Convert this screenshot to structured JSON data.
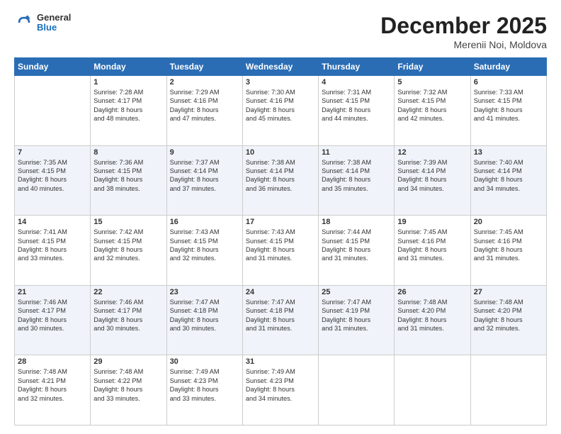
{
  "header": {
    "logo": {
      "general": "General",
      "blue": "Blue"
    },
    "title": "December 2025",
    "subtitle": "Merenii Noi, Moldova"
  },
  "weekdays": [
    "Sunday",
    "Monday",
    "Tuesday",
    "Wednesday",
    "Thursday",
    "Friday",
    "Saturday"
  ],
  "rows": [
    [
      {
        "day": "",
        "content": ""
      },
      {
        "day": "1",
        "content": "Sunrise: 7:28 AM\nSunset: 4:17 PM\nDaylight: 8 hours\nand 48 minutes."
      },
      {
        "day": "2",
        "content": "Sunrise: 7:29 AM\nSunset: 4:16 PM\nDaylight: 8 hours\nand 47 minutes."
      },
      {
        "day": "3",
        "content": "Sunrise: 7:30 AM\nSunset: 4:16 PM\nDaylight: 8 hours\nand 45 minutes."
      },
      {
        "day": "4",
        "content": "Sunrise: 7:31 AM\nSunset: 4:15 PM\nDaylight: 8 hours\nand 44 minutes."
      },
      {
        "day": "5",
        "content": "Sunrise: 7:32 AM\nSunset: 4:15 PM\nDaylight: 8 hours\nand 42 minutes."
      },
      {
        "day": "6",
        "content": "Sunrise: 7:33 AM\nSunset: 4:15 PM\nDaylight: 8 hours\nand 41 minutes."
      }
    ],
    [
      {
        "day": "7",
        "content": "Sunrise: 7:35 AM\nSunset: 4:15 PM\nDaylight: 8 hours\nand 40 minutes."
      },
      {
        "day": "8",
        "content": "Sunrise: 7:36 AM\nSunset: 4:15 PM\nDaylight: 8 hours\nand 38 minutes."
      },
      {
        "day": "9",
        "content": "Sunrise: 7:37 AM\nSunset: 4:14 PM\nDaylight: 8 hours\nand 37 minutes."
      },
      {
        "day": "10",
        "content": "Sunrise: 7:38 AM\nSunset: 4:14 PM\nDaylight: 8 hours\nand 36 minutes."
      },
      {
        "day": "11",
        "content": "Sunrise: 7:38 AM\nSunset: 4:14 PM\nDaylight: 8 hours\nand 35 minutes."
      },
      {
        "day": "12",
        "content": "Sunrise: 7:39 AM\nSunset: 4:14 PM\nDaylight: 8 hours\nand 34 minutes."
      },
      {
        "day": "13",
        "content": "Sunrise: 7:40 AM\nSunset: 4:14 PM\nDaylight: 8 hours\nand 34 minutes."
      }
    ],
    [
      {
        "day": "14",
        "content": "Sunrise: 7:41 AM\nSunset: 4:15 PM\nDaylight: 8 hours\nand 33 minutes."
      },
      {
        "day": "15",
        "content": "Sunrise: 7:42 AM\nSunset: 4:15 PM\nDaylight: 8 hours\nand 32 minutes."
      },
      {
        "day": "16",
        "content": "Sunrise: 7:43 AM\nSunset: 4:15 PM\nDaylight: 8 hours\nand 32 minutes."
      },
      {
        "day": "17",
        "content": "Sunrise: 7:43 AM\nSunset: 4:15 PM\nDaylight: 8 hours\nand 31 minutes."
      },
      {
        "day": "18",
        "content": "Sunrise: 7:44 AM\nSunset: 4:15 PM\nDaylight: 8 hours\nand 31 minutes."
      },
      {
        "day": "19",
        "content": "Sunrise: 7:45 AM\nSunset: 4:16 PM\nDaylight: 8 hours\nand 31 minutes."
      },
      {
        "day": "20",
        "content": "Sunrise: 7:45 AM\nSunset: 4:16 PM\nDaylight: 8 hours\nand 31 minutes."
      }
    ],
    [
      {
        "day": "21",
        "content": "Sunrise: 7:46 AM\nSunset: 4:17 PM\nDaylight: 8 hours\nand 30 minutes."
      },
      {
        "day": "22",
        "content": "Sunrise: 7:46 AM\nSunset: 4:17 PM\nDaylight: 8 hours\nand 30 minutes."
      },
      {
        "day": "23",
        "content": "Sunrise: 7:47 AM\nSunset: 4:18 PM\nDaylight: 8 hours\nand 30 minutes."
      },
      {
        "day": "24",
        "content": "Sunrise: 7:47 AM\nSunset: 4:18 PM\nDaylight: 8 hours\nand 31 minutes."
      },
      {
        "day": "25",
        "content": "Sunrise: 7:47 AM\nSunset: 4:19 PM\nDaylight: 8 hours\nand 31 minutes."
      },
      {
        "day": "26",
        "content": "Sunrise: 7:48 AM\nSunset: 4:20 PM\nDaylight: 8 hours\nand 31 minutes."
      },
      {
        "day": "27",
        "content": "Sunrise: 7:48 AM\nSunset: 4:20 PM\nDaylight: 8 hours\nand 32 minutes."
      }
    ],
    [
      {
        "day": "28",
        "content": "Sunrise: 7:48 AM\nSunset: 4:21 PM\nDaylight: 8 hours\nand 32 minutes."
      },
      {
        "day": "29",
        "content": "Sunrise: 7:48 AM\nSunset: 4:22 PM\nDaylight: 8 hours\nand 33 minutes."
      },
      {
        "day": "30",
        "content": "Sunrise: 7:49 AM\nSunset: 4:23 PM\nDaylight: 8 hours\nand 33 minutes."
      },
      {
        "day": "31",
        "content": "Sunrise: 7:49 AM\nSunset: 4:23 PM\nDaylight: 8 hours\nand 34 minutes."
      },
      {
        "day": "",
        "content": ""
      },
      {
        "day": "",
        "content": ""
      },
      {
        "day": "",
        "content": ""
      }
    ]
  ]
}
